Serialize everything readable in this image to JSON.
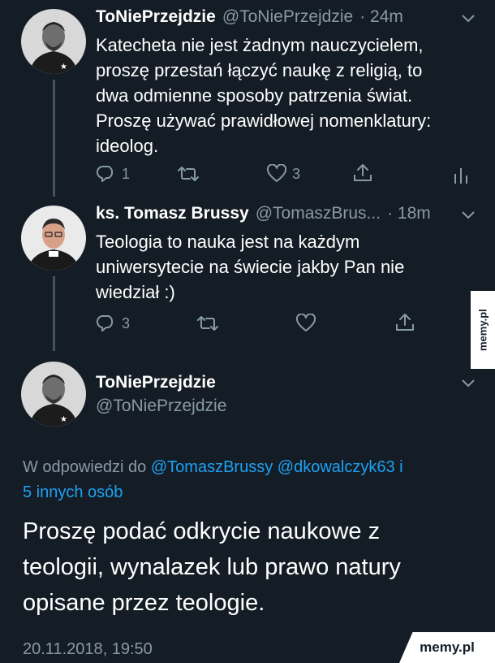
{
  "tweet1": {
    "name": "ToNiePrzejdzie",
    "handle": "@ToNiePrzejdzie",
    "time": "· 24m",
    "lines": [
      "Katecheta nie jest żadnym nauczycielem,",
      "proszę przestań łączyć naukę z religią, to",
      "dwa odmienne sposoby patrzenia świat.",
      "Proszę używać prawidłowej nomenklatury:",
      "ideolog."
    ],
    "reply_count": "1",
    "like_count": "3"
  },
  "tweet2": {
    "name": "ks. Tomasz Brussy",
    "handle": "@TomaszBrus...",
    "time": "· 18m",
    "lines": [
      "Teologia to nauka jest na każdym",
      "uniwersytecie na świecie jakby Pan nie",
      "wiedział :)"
    ],
    "reply_count": "3"
  },
  "main_tweet": {
    "name": "ToNiePrzejdzie",
    "handle": "@ToNiePrzejdzie",
    "reply_prefix": "W odpowiedzi do",
    "reply_mention1": "@TomaszBrussy",
    "reply_mention2": "@dkowalczyk63",
    "reply_conj": "i",
    "reply_others": "5 innych osób",
    "lines": [
      "Proszę podać odkrycie naukowe z",
      "teologii, wynalazek lub prawo natury",
      "opisane przez teologie."
    ],
    "timestamp": "20.11.2018, 19:50"
  },
  "watermark": {
    "side": "memy.pl",
    "corner": "memy.pl"
  },
  "colors": {
    "background": "#141d26",
    "secondary_text": "#8899a6",
    "link": "#1da1f2"
  }
}
